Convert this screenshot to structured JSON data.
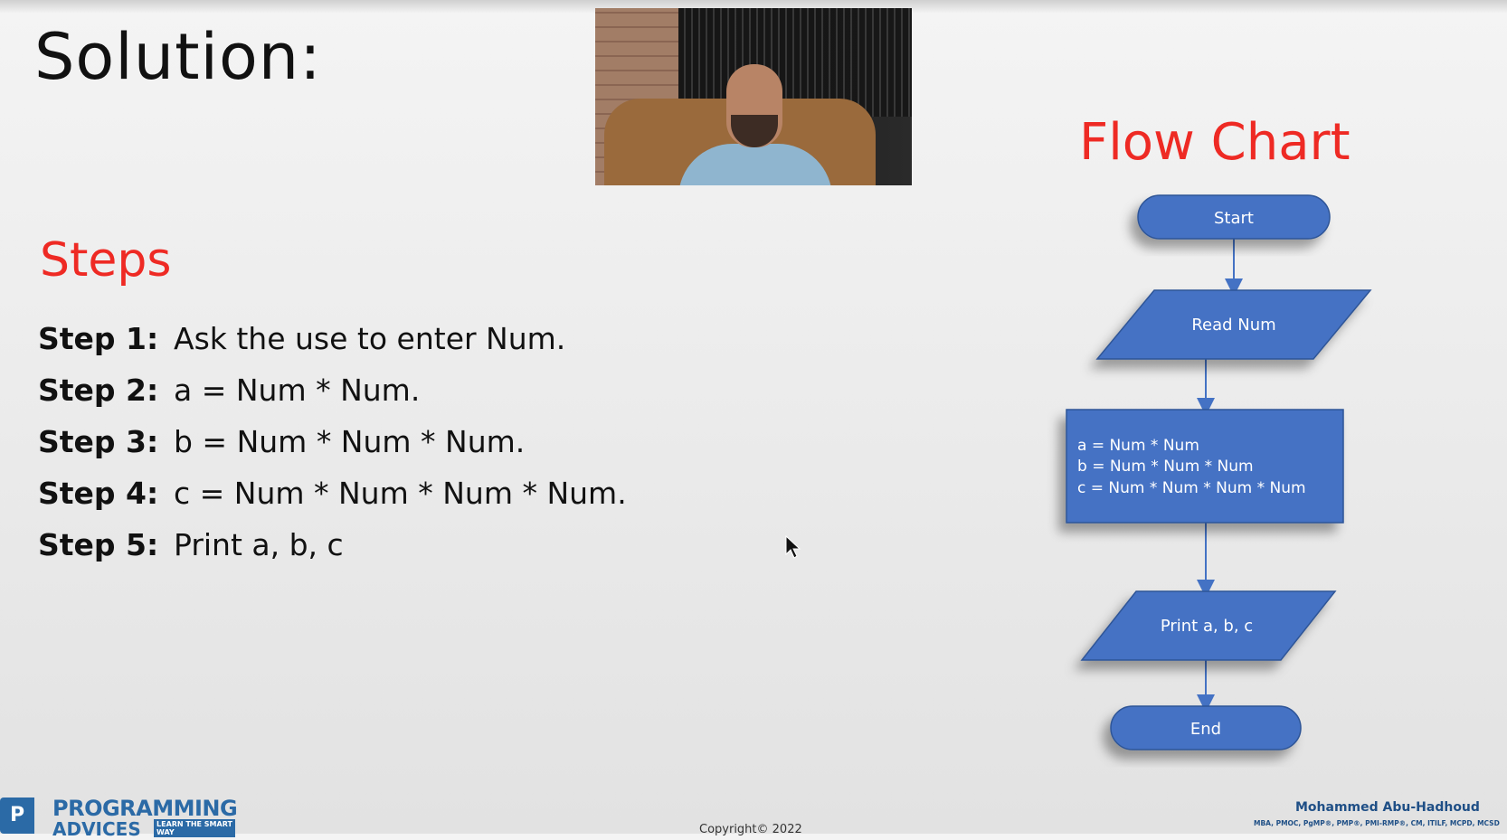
{
  "slide": {
    "title": "Solution:",
    "steps_heading": "Steps",
    "steps": [
      {
        "label": "Step 1:",
        "text": "Ask the use to enter Num."
      },
      {
        "label": "Step 2:",
        "text": "a = Num * Num."
      },
      {
        "label": "Step 3:",
        "text": "b = Num * Num * Num."
      },
      {
        "label": "Step 4:",
        "text": "c = Num * Num * Num * Num."
      },
      {
        "label": "Step 5:",
        "text": "Print a, b, c"
      }
    ],
    "flow_title": "Flow Chart",
    "flow": {
      "start": "Start",
      "input": "Read Num",
      "process": [
        "a = Num * Num",
        "b = Num * Num * Num",
        "c = Num * Num * Num * Num"
      ],
      "output": "Print a, b, c",
      "end": "End"
    },
    "colors": {
      "accent_red": "#ee2a24",
      "flow_blue": "#4472c4",
      "brand_blue": "#2b6aa6"
    }
  },
  "footer": {
    "logo_line1": "PROGRAMMING",
    "logo_line2": "ADVICES",
    "logo_tag": "LEARN THE SMART WAY",
    "copyright": "Copyright© 2022",
    "author": "Mohammed Abu-Hadhoud",
    "credentials": "MBA, PMOC, PgMP®, PMP®, PMI-RMP®, CM, ITILF, MCPD, MCSD"
  },
  "video_overlay": {
    "icon": "presenter-webcam"
  }
}
